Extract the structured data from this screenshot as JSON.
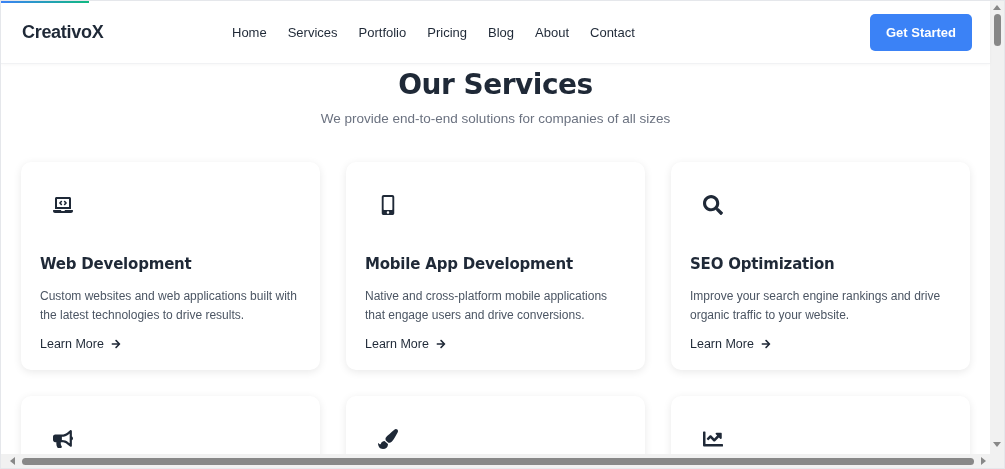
{
  "scroll_progress": {
    "level": 0.089
  },
  "header": {
    "logo": "CreativoX",
    "nav": [
      "Home",
      "Services",
      "Portfolio",
      "Pricing",
      "Blog",
      "About",
      "Contact"
    ],
    "cta": "Get Started"
  },
  "section": {
    "title": "Our Services",
    "subtitle": "We provide end-to-end solutions for companies of all sizes"
  },
  "services": [
    {
      "kind": "full",
      "title": "Web Development",
      "description": "Custom websites and web applications built with the latest technologies to drive results.",
      "link": "Learn More"
    },
    {
      "kind": "full",
      "title": "Mobile App Development",
      "description": "Native and cross-platform mobile applications that engage users and drive conversions.",
      "link": "Learn More"
    },
    {
      "kind": "full",
      "title": "SEO Optimization",
      "description": "Improve your search engine rankings and drive organic traffic to your website.",
      "link": "Learn More"
    },
    {
      "kind": "partial"
    },
    {
      "kind": "partial"
    },
    {
      "kind": "partial"
    }
  ]
}
